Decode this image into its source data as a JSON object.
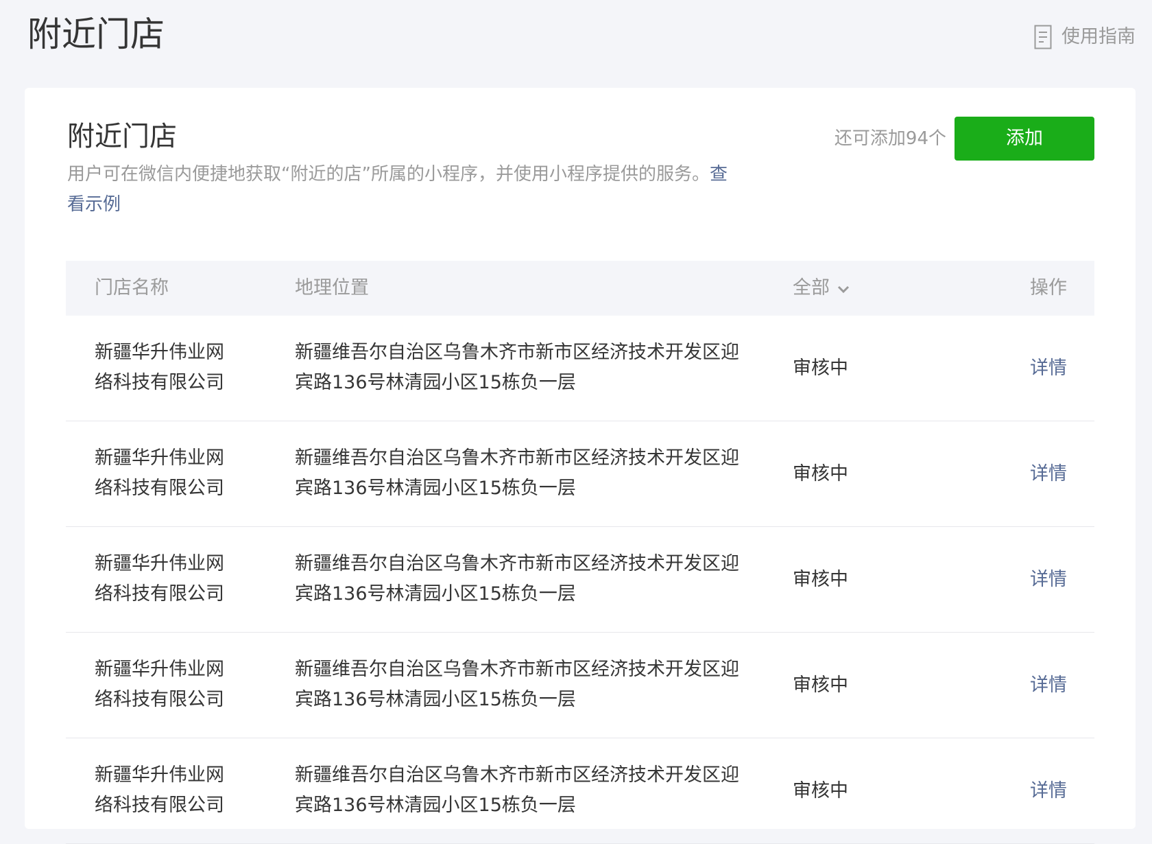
{
  "header": {
    "title": "附近门店",
    "guide_label": "使用指南",
    "guide_icon": "document-icon"
  },
  "card": {
    "title": "附近门店",
    "description": "用户可在微信内便捷地获取“附近的店”所属的小程序，并使用小程序提供的服务。",
    "example_link": "查看示例",
    "remaining": "还可添加94个",
    "add_button": "添加",
    "accent_color": "#1aad19",
    "link_color": "#576b95"
  },
  "table": {
    "headers": {
      "name": "门店名称",
      "location": "地理位置",
      "status_filter": "全部",
      "operation": "操作"
    },
    "rows": [
      {
        "name": "新疆华升伟业网络科技有限公司",
        "location": "新疆维吾尔自治区乌鲁木齐市新市区经济技术开发区迎宾路136号林清园小区15栋负一层",
        "status": "审核中",
        "action": "详情"
      },
      {
        "name": "新疆华升伟业网络科技有限公司",
        "location": "新疆维吾尔自治区乌鲁木齐市新市区经济技术开发区迎宾路136号林清园小区15栋负一层",
        "status": "审核中",
        "action": "详情"
      },
      {
        "name": "新疆华升伟业网络科技有限公司",
        "location": "新疆维吾尔自治区乌鲁木齐市新市区经济技术开发区迎宾路136号林清园小区15栋负一层",
        "status": "审核中",
        "action": "详情"
      },
      {
        "name": "新疆华升伟业网络科技有限公司",
        "location": "新疆维吾尔自治区乌鲁木齐市新市区经济技术开发区迎宾路136号林清园小区15栋负一层",
        "status": "审核中",
        "action": "详情"
      },
      {
        "name": "新疆华升伟业网络科技有限公司",
        "location": "新疆维吾尔自治区乌鲁木齐市新市区经济技术开发区迎宾路136号林清园小区15栋负一层",
        "status": "审核中",
        "action": "详情"
      }
    ]
  }
}
